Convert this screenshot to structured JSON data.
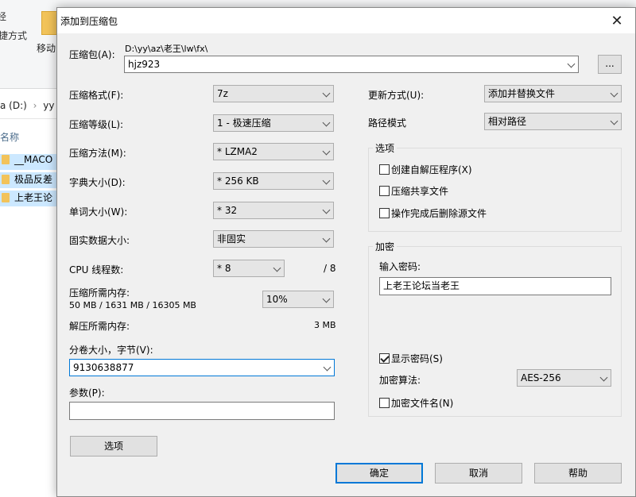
{
  "explorer": {
    "ribbon_text1": "经",
    "ribbon_text2": "捷方式",
    "move_label": "移动",
    "address_drive": "a (D:)",
    "address_sep": "›",
    "address_folder": "yy",
    "column_name": "名称",
    "rows": [
      "__MACO",
      "极品反差",
      "上老王论"
    ]
  },
  "dialog": {
    "title": "添加到压缩包",
    "archive_label": "压缩包(A):",
    "archive_path": "D:\\yy\\az\\老王\\lw\\fx\\",
    "archive_name": "hjz923",
    "browse_label": "...",
    "format_label": "压缩格式(F):",
    "format_value": "7z",
    "level_label": "压缩等级(L):",
    "level_value": "1 - 极速压缩",
    "method_label": "压缩方法(M):",
    "method_value": "* LZMA2",
    "dict_label": "字典大小(D):",
    "dict_value": "* 256 KB",
    "word_label": "单词大小(W):",
    "word_value": "* 32",
    "solid_label": "固实数据大小:",
    "solid_value": "非固实",
    "cpu_label": "CPU 线程数:",
    "cpu_value": "* 8",
    "cpu_total": "/ 8",
    "mem_comp_label": "压缩所需内存:",
    "mem_comp_detail": "50 MB / 1631 MB / 16305 MB",
    "mem_comp_value": "10%",
    "mem_decomp_label": "解压所需内存:",
    "mem_decomp_value": "3 MB",
    "split_label": "分卷大小，字节(V):",
    "split_value": "9130638877",
    "params_label": "参数(P):",
    "params_value": "",
    "options_button": "选项",
    "update_label": "更新方式(U):",
    "update_value": "添加并替换文件",
    "path_label": "路径模式",
    "path_value": "相对路径",
    "options_group": "选项",
    "opt_sfx": "创建自解压程序(X)",
    "opt_shared": "压缩共享文件",
    "opt_delete": "操作完成后删除源文件",
    "encrypt_group": "加密",
    "password_label": "输入密码:",
    "password_value": "上老王论坛当老王",
    "show_password": "显示密码(S)",
    "encrypt_method_label": "加密算法:",
    "encrypt_method_value": "AES-256",
    "encrypt_names": "加密文件名(N)",
    "ok_button": "确定",
    "cancel_button": "取消",
    "help_button": "帮助"
  },
  "colors": {
    "accent": "#0078d7",
    "selection": "#cce8ff"
  }
}
